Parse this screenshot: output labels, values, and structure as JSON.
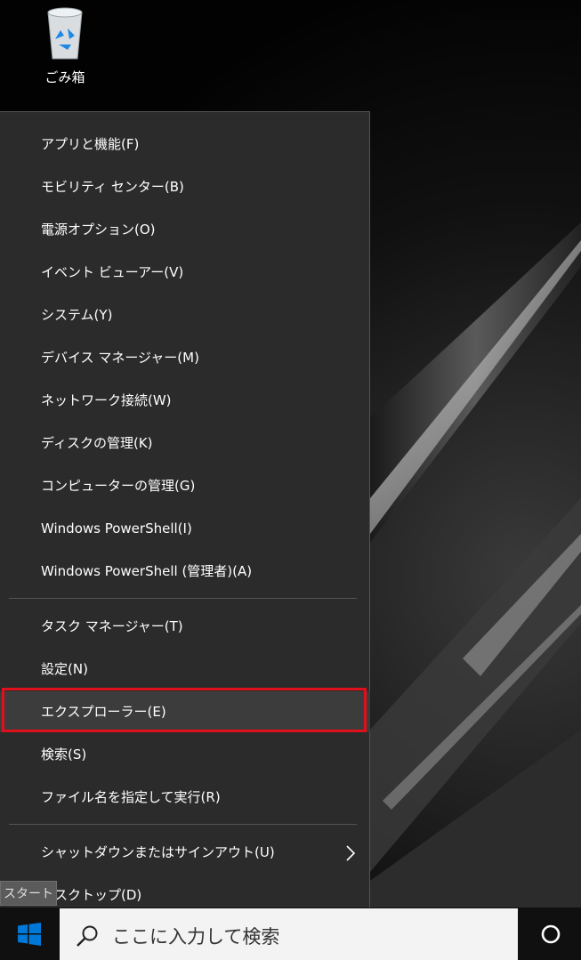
{
  "desktop": {
    "recycle_bin_label": "ごみ箱"
  },
  "winx_menu": {
    "group1": [
      {
        "label": "アプリと機能(F)"
      },
      {
        "label": "モビリティ センター(B)"
      },
      {
        "label": "電源オプション(O)"
      },
      {
        "label": "イベント ビューアー(V)"
      },
      {
        "label": "システム(Y)"
      },
      {
        "label": "デバイス マネージャー(M)"
      },
      {
        "label": "ネットワーク接続(W)"
      },
      {
        "label": "ディスクの管理(K)"
      },
      {
        "label": "コンピューターの管理(G)"
      },
      {
        "label": "Windows PowerShell(I)"
      },
      {
        "label": "Windows PowerShell (管理者)(A)"
      }
    ],
    "group2": [
      {
        "label": "タスク マネージャー(T)"
      },
      {
        "label": "設定(N)"
      },
      {
        "label": "エクスプローラー(E)",
        "selected": true
      },
      {
        "label": "検索(S)"
      },
      {
        "label": "ファイル名を指定して実行(R)"
      }
    ],
    "group3": [
      {
        "label": "シャットダウンまたはサインアウト(U)",
        "has_submenu": true,
        "icon": "chevron-right-icon"
      },
      {
        "label": "デスクトップ(D)"
      }
    ],
    "highlight_color": "#e0101a"
  },
  "tooltip": {
    "text": "スタート"
  },
  "taskbar": {
    "start_icon": "windows-logo-icon",
    "search_placeholder": "ここに入力して検索",
    "search_icon": "search-icon",
    "cortana_icon": "cortana-circle-icon",
    "accent_color": "#0078d7"
  }
}
